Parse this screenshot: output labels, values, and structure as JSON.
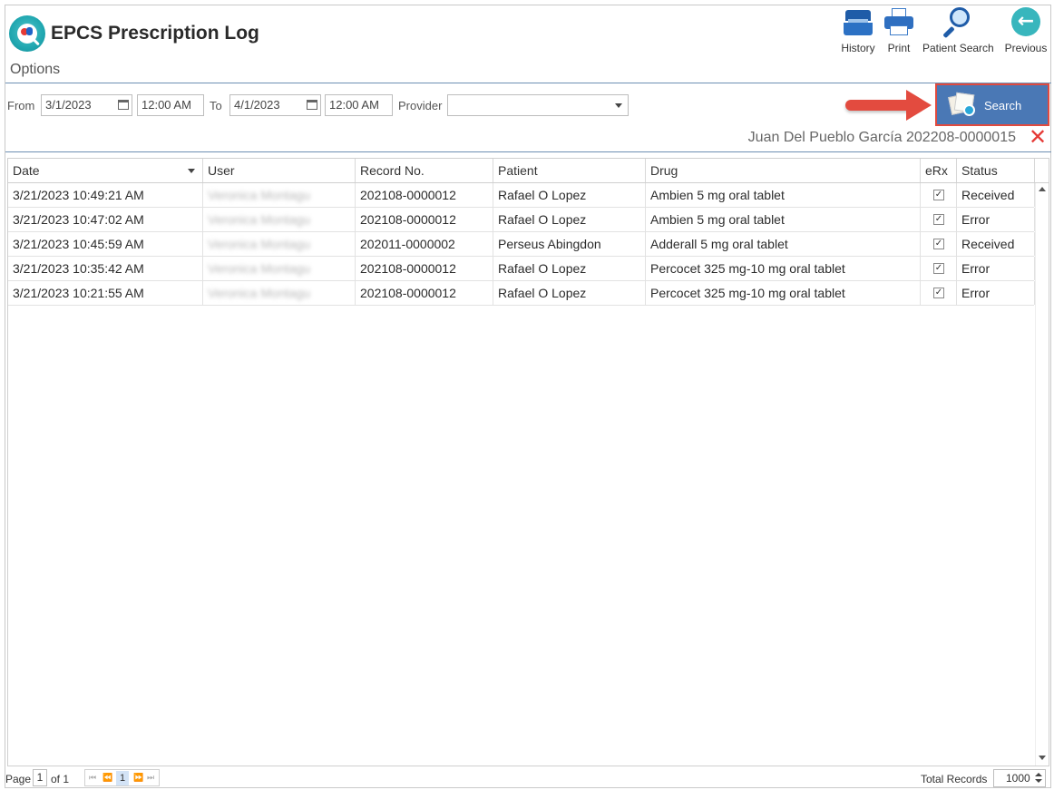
{
  "header": {
    "title": "EPCS Prescription Log",
    "options_label": "Options",
    "toolbar": [
      {
        "label": "History",
        "icon": "history-icon"
      },
      {
        "label": "Print",
        "icon": "print-icon"
      },
      {
        "label": "Patient Search",
        "icon": "magnifier-icon"
      },
      {
        "label": "Previous",
        "icon": "back-arrow-icon"
      }
    ]
  },
  "filters": {
    "from_label": "From",
    "from_date": "3/1/2023",
    "from_time": "12:00 AM",
    "to_label": "To",
    "to_date": "4/1/2023",
    "to_time": "12:00 AM",
    "provider_label": "Provider",
    "provider_value": "",
    "search_label": "Search"
  },
  "patient_banner": "Juan Del Pueblo García 202208-0000015",
  "grid": {
    "columns": [
      "Date",
      "User",
      "Record No.",
      "Patient",
      "Drug",
      "eRx",
      "Status"
    ],
    "rows": [
      {
        "date": "3/21/2023 10:49:21 AM",
        "user": "Veronica Montagu",
        "record": "202108-0000012",
        "patient": "Rafael O Lopez",
        "drug": "Ambien 5 mg oral tablet",
        "erx": "✓",
        "status": "Received"
      },
      {
        "date": "3/21/2023 10:47:02 AM",
        "user": "Veronica Montagu",
        "record": "202108-0000012",
        "patient": "Rafael O Lopez",
        "drug": "Ambien 5 mg oral tablet",
        "erx": "✓",
        "status": "Error"
      },
      {
        "date": "3/21/2023 10:45:59 AM",
        "user": "Veronica Montagu",
        "record": "202011-0000002",
        "patient": "Perseus Abingdon",
        "drug": "Adderall 5 mg oral tablet",
        "erx": "✓",
        "status": "Received"
      },
      {
        "date": "3/21/2023 10:35:42 AM",
        "user": "Veronica Montagu",
        "record": "202108-0000012",
        "patient": "Rafael O Lopez",
        "drug": "Percocet 325 mg-10 mg oral tablet",
        "erx": "✓",
        "status": "Error"
      },
      {
        "date": "3/21/2023 10:21:55 AM",
        "user": "Veronica Montagu",
        "record": "202108-0000012",
        "patient": "Rafael O Lopez",
        "drug": "Percocet 325 mg-10 mg oral tablet",
        "erx": "✓",
        "status": "Error"
      }
    ]
  },
  "footer": {
    "page_label": "Page",
    "page_value": "1",
    "of_label": "of 1",
    "current_page": "1",
    "total_records_label": "Total Records",
    "total_records_value": "1000"
  },
  "colors": {
    "accent_teal": "#38b6bd",
    "search_button": "#4a78b5",
    "highlight_red": "#e34b3f"
  }
}
